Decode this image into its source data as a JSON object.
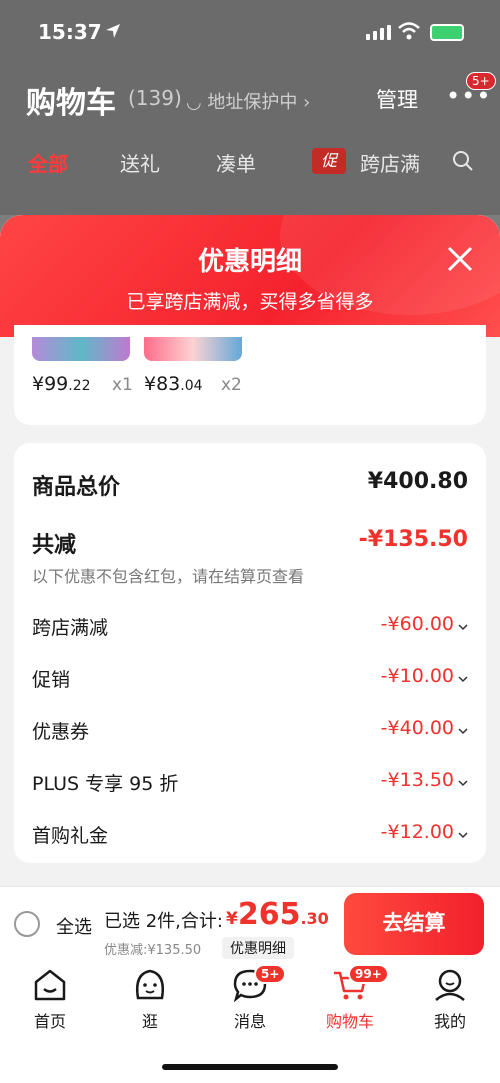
{
  "status_bar": {
    "time": "15:37"
  },
  "cart_header": {
    "title": "购物车",
    "count": "(139)",
    "address_protect": "◡ 地址保护中 ›",
    "manage": "管理",
    "more": "•••",
    "more_badge": "5+"
  },
  "tabs": [
    {
      "label": "全部"
    },
    {
      "label": "送礼"
    },
    {
      "label": "凑单"
    },
    {
      "label": "跨店满"
    }
  ],
  "promo_chip": "促",
  "sheet": {
    "title": "优惠明细",
    "subtitle": "已享跨店满减，买得多省得多"
  },
  "items": [
    {
      "currency": "¥",
      "int": "99",
      "dec": ".22",
      "qty": "x1"
    },
    {
      "currency": "¥",
      "int": "83",
      "dec": ".04",
      "qty": "x2"
    }
  ],
  "summary": {
    "goods_total_label": "商品总价",
    "goods_total_value": "¥400.80",
    "total_reduce_label": "共减",
    "total_reduce_value": "-¥135.50",
    "note": "以下优惠不包含红包，请在结算页查看",
    "discounts": [
      {
        "label": "跨店满减",
        "value": "-¥60.00"
      },
      {
        "label": "促销",
        "value": "-¥10.00"
      },
      {
        "label": "优惠券",
        "value": "-¥40.00"
      },
      {
        "label": "PLUS 专享 95 折",
        "value": "-¥13.50"
      },
      {
        "label": "首购礼金",
        "value": "-¥12.00"
      }
    ]
  },
  "checkout": {
    "select_all": "全选",
    "selected_text": "已选 2件,合计:",
    "total_currency": "¥",
    "total_int": "265",
    "total_dec": ".30",
    "discount_line": "优惠减:¥135.50",
    "discount_detail": "优惠明细",
    "button": "去结算"
  },
  "tab_bar": [
    {
      "label": "首页"
    },
    {
      "label": "逛"
    },
    {
      "label": "消息",
      "badge": "5+"
    },
    {
      "label": "购物车",
      "badge": "99+"
    },
    {
      "label": "我的"
    }
  ],
  "colors": {
    "accent": "#f0322d",
    "header_red": "#f5222d"
  }
}
